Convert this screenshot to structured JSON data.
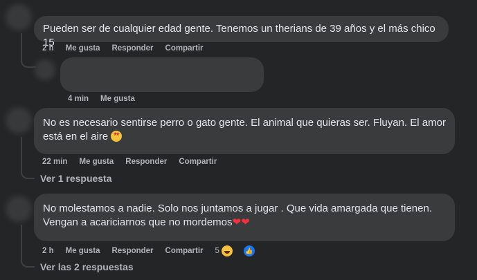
{
  "comments": [
    {
      "text": "Pueden ser de cualquier edad gente. Tenemos un therians de 39 años y el más chico 15",
      "time": "2 h",
      "like": "Me gusta",
      "reply": "Responder",
      "share": "Compartir"
    },
    {
      "text": "",
      "time": "4 min",
      "like": "Me gusta"
    },
    {
      "text_line1": "No es necesario sentirse perro o gato gente. El animal que quieras ser. Fluyan. El amor",
      "text_line2": "está en el aire",
      "emoji": "star-struck",
      "time": "22 min",
      "like": "Me gusta",
      "reply": "Responder",
      "share": "Compartir",
      "replies_link": "Ver 1 respuesta"
    },
    {
      "text_line1": "No molestamos a nadie. Solo nos juntamos a jugar . Que vida amargada que tienen.",
      "text_line2": "Vengan a acariciarnos que no mordemos",
      "hearts": "❤❤",
      "time": "2 h",
      "like": "Me gusta",
      "reply": "Responder",
      "share": "Compartir",
      "reaction_count": "5",
      "replies_link": "Ver las 2 respuestas"
    }
  ],
  "colors": {
    "background": "#242526",
    "bubble": "#3a3b3c",
    "text": "#e4e6eb",
    "meta": "#b0b3b8",
    "like_blue": "#1877f2"
  }
}
